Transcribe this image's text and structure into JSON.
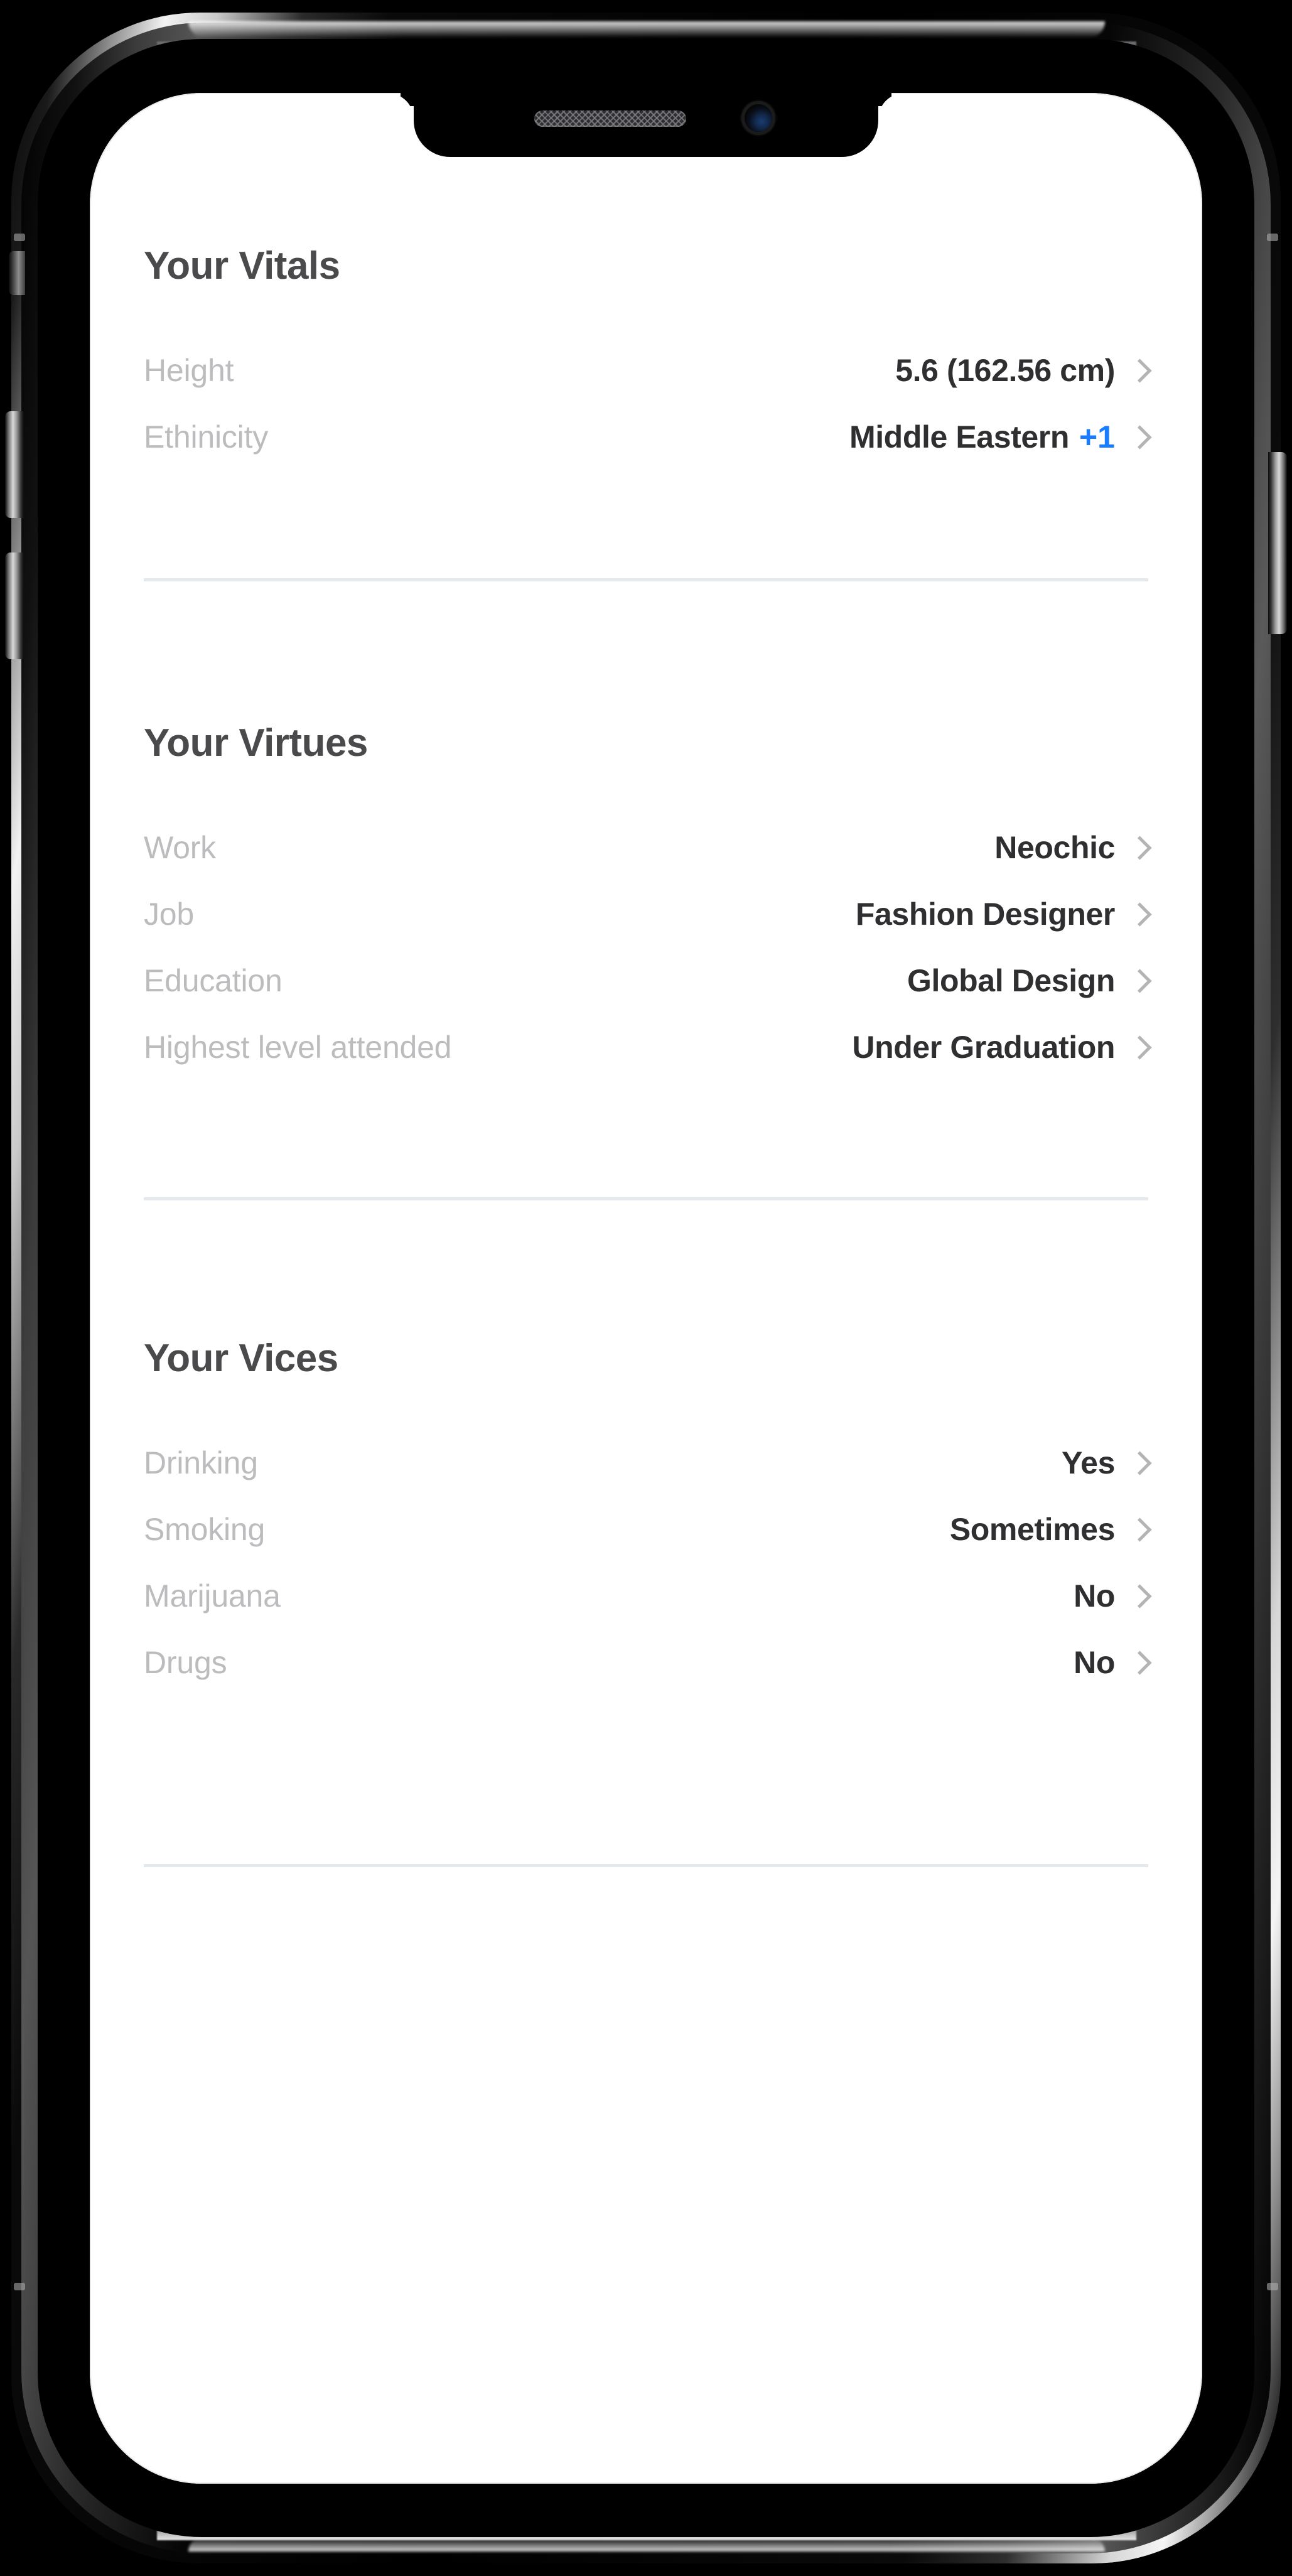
{
  "device": {
    "name": "smartphone-mockup",
    "notch": {
      "speaker": "earpiece-speaker",
      "camera": "front-camera"
    },
    "buttons": {
      "silent_switch": "silent-switch",
      "volume_up": "volume-up-button",
      "volume_down": "volume-down-button",
      "power": "power-button"
    }
  },
  "colors": {
    "accent_blue": "#1a7cff",
    "label_gray": "#bcbcbe",
    "value_dark": "#2f2f31",
    "heading_gray": "#4a4a4c",
    "divider": "#e4e8ef",
    "chevron": "#b4b4b6",
    "screen_bg": "#ffffff"
  },
  "sections": [
    {
      "id": "vitals",
      "title": "Your Vitals",
      "rows": [
        {
          "label": "Height",
          "value": "5.6 (162.56 cm)",
          "badge": "",
          "chevron": "chevron-right-icon"
        },
        {
          "label": "Ethinicity",
          "value": "Middle Eastern",
          "badge": "+1",
          "chevron": "chevron-right-icon"
        }
      ]
    },
    {
      "id": "virtues",
      "title": "Your Virtues",
      "rows": [
        {
          "label": "Work",
          "value": "Neochic",
          "badge": "",
          "chevron": "chevron-right-icon"
        },
        {
          "label": "Job",
          "value": "Fashion Designer",
          "badge": "",
          "chevron": "chevron-right-icon"
        },
        {
          "label": "Education",
          "value": "Global Design",
          "badge": "",
          "chevron": "chevron-right-icon"
        },
        {
          "label": "Highest level attended",
          "value": "Under Graduation",
          "badge": "",
          "chevron": "chevron-right-icon"
        }
      ]
    },
    {
      "id": "vices",
      "title": "Your Vices",
      "rows": [
        {
          "label": "Drinking",
          "value": "Yes",
          "badge": "",
          "chevron": "chevron-right-icon"
        },
        {
          "label": "Smoking",
          "value": "Sometimes",
          "badge": "",
          "chevron": "chevron-right-icon"
        },
        {
          "label": "Marijuana",
          "value": "No",
          "badge": "",
          "chevron": "chevron-right-icon"
        },
        {
          "label": "Drugs",
          "value": "No",
          "badge": "",
          "chevron": "chevron-right-icon"
        }
      ]
    }
  ]
}
